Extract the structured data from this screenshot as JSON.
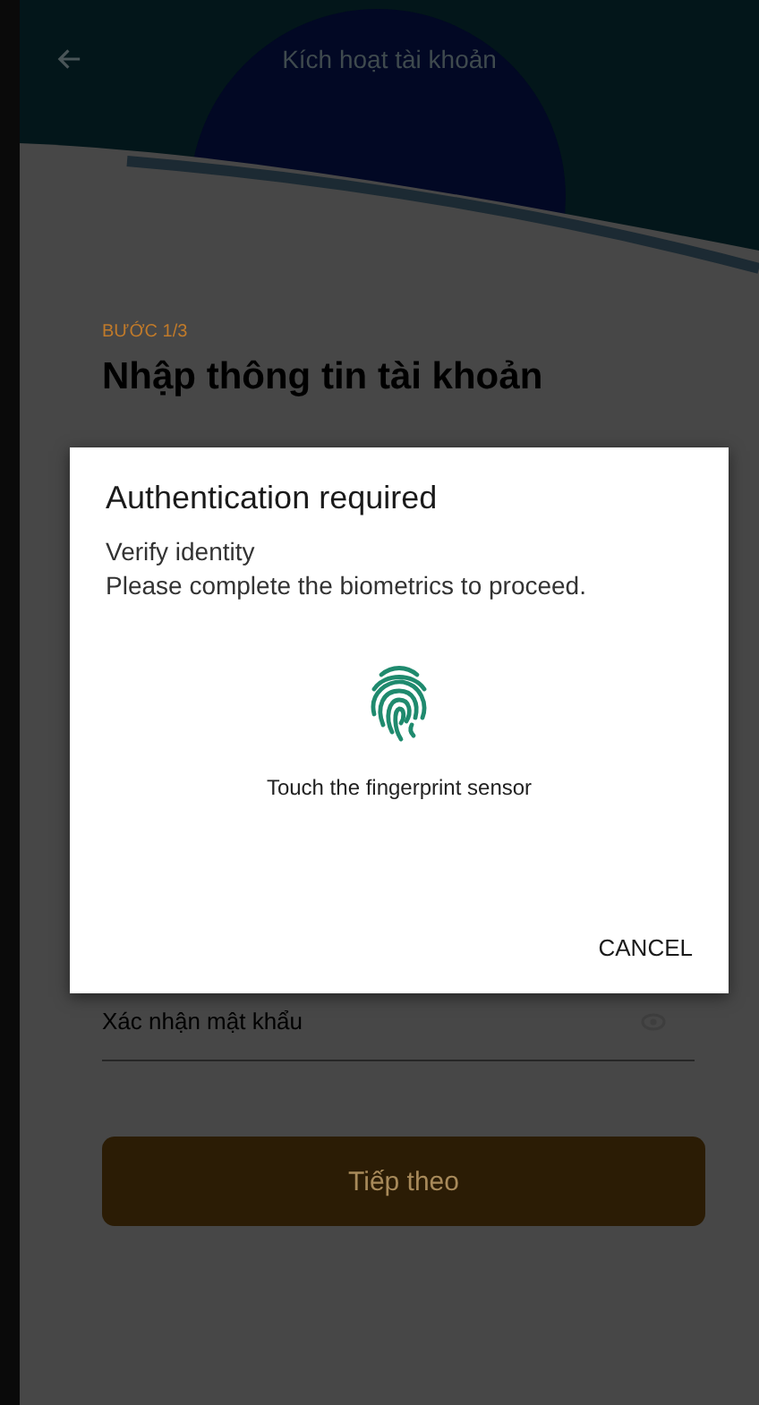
{
  "app_bar": {
    "title": "Kích hoạt tài khoản"
  },
  "form": {
    "step": "BƯỚC 1/3",
    "heading": "Nhập thông tin tài khoản",
    "fields": [
      {
        "placeholder": "Xác nhận mật khẩu"
      }
    ],
    "next_button": "Tiếp theo"
  },
  "dialog": {
    "title": "Authentication required",
    "subtitle": "Verify identity",
    "description": "Please complete the biometrics to proceed.",
    "prompt": "Touch the fingerprint sensor",
    "cancel_button": "CANCEL"
  }
}
